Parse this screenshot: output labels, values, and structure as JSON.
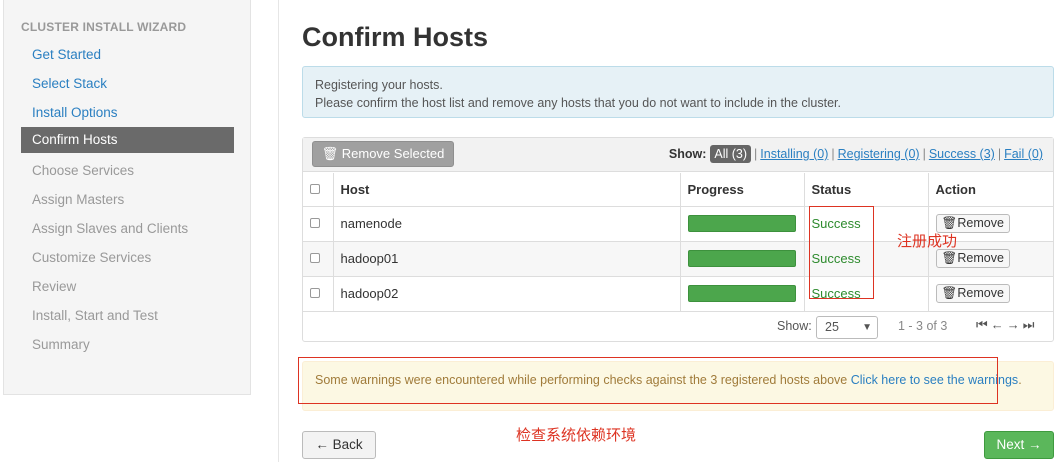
{
  "sidebar": {
    "header": "CLUSTER INSTALL WIZARD",
    "items": [
      {
        "label": "Get Started"
      },
      {
        "label": "Select Stack"
      },
      {
        "label": "Install Options"
      },
      {
        "label": "Confirm Hosts"
      },
      {
        "label": "Choose Services"
      },
      {
        "label": "Assign Masters"
      },
      {
        "label": "Assign Slaves and Clients"
      },
      {
        "label": "Customize Services"
      },
      {
        "label": "Review"
      },
      {
        "label": "Install, Start and Test"
      },
      {
        "label": "Summary"
      }
    ]
  },
  "page_title": "Confirm Hosts",
  "info": {
    "line1": "Registering your hosts.",
    "line2": "Please confirm the host list and remove any hosts that you do not want to include in the cluster."
  },
  "toolbar": {
    "remove_selected": "Remove Selected",
    "show_label": "Show:",
    "filters": {
      "all": "All (3)",
      "installing": "Installing (0)",
      "registering": "Registering (0)",
      "success": "Success (3)",
      "fail": "Fail (0)"
    }
  },
  "table": {
    "headers": {
      "host": "Host",
      "progress": "Progress",
      "status": "Status",
      "action": "Action"
    },
    "rows": [
      {
        "host": "namenode",
        "status": "Success",
        "action": "Remove",
        "progress": 100
      },
      {
        "host": "hadoop01",
        "status": "Success",
        "action": "Remove",
        "progress": 100
      },
      {
        "host": "hadoop02",
        "status": "Success",
        "action": "Remove",
        "progress": 100
      }
    ]
  },
  "pager": {
    "show_label": "Show:",
    "page_size": "25",
    "range": "1 - 3 of 3"
  },
  "warning": {
    "text": "Some warnings were encountered while performing checks against the 3 registered hosts above",
    "link": "Click here to see the warnings",
    "end": "."
  },
  "annotations": {
    "status_note": "注册成功",
    "env_note": "检查系统依赖环境"
  },
  "buttons": {
    "back": "← Back",
    "next": "Next →"
  },
  "colors": {
    "accent": "#2a7fc1",
    "success": "#5bb75b",
    "annotation": "#dd3322"
  }
}
